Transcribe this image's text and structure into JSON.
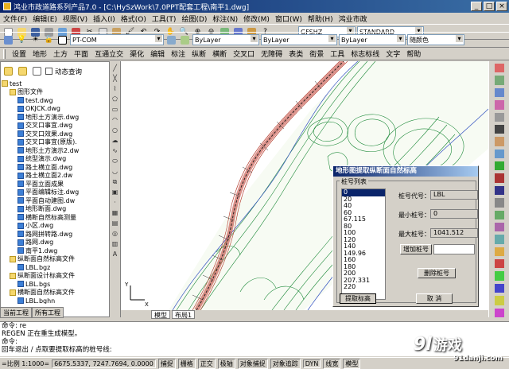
{
  "window": {
    "title": "鸿业市政道路系列产品7.0 - [C:\\HySzWork\\7.0PPT配套工程\\南平1.dwg]"
  },
  "menu1": [
    "文件(F)",
    "编辑(E)",
    "视图(V)",
    "插入(I)",
    "格式(O)",
    "工具(T)",
    "绘图(D)",
    "标注(N)",
    "修改(M)",
    "窗口(W)",
    "帮助(H)",
    "鸿业市政"
  ],
  "toolbar": {
    "layer_combo": "PT-COM",
    "color_combo": "ByLayer",
    "linetype_combo": "ByLayer",
    "lineweight_combo": "ByLayer",
    "plotstyle_combo": "随颜色",
    "textstyle_combo": "GFSHZ",
    "dimstyle_combo": "STANDARD"
  },
  "menu2": [
    "设置",
    "地形",
    "土方",
    "平面",
    "互通立交",
    "渠化",
    "编辑",
    "标注",
    "纵断",
    "横断",
    "交叉口",
    "无障碍",
    "表类",
    "街景",
    "工具",
    "标志标线",
    "文字",
    "帮助"
  ],
  "left_panel": {
    "checkbox_label": "动态查询",
    "tree": [
      {
        "level": 0,
        "type": "fold",
        "label": "test"
      },
      {
        "level": 1,
        "type": "fold",
        "label": "图形文件"
      },
      {
        "level": 2,
        "type": "file",
        "label": "test.dwg"
      },
      {
        "level": 2,
        "type": "file",
        "label": "OKJCK.dwg"
      },
      {
        "level": 2,
        "type": "file",
        "label": "地形土方演示.dwg"
      },
      {
        "level": 2,
        "type": "file",
        "label": "交叉口事宜.dwg"
      },
      {
        "level": 2,
        "type": "file",
        "label": "交叉口效果.dwg"
      },
      {
        "level": 2,
        "type": "file",
        "label": "交叉口事宜(原版)."
      },
      {
        "level": 2,
        "type": "file",
        "label": "地形土方演示2.dw"
      },
      {
        "level": 2,
        "type": "file",
        "label": "统型演示.dwg"
      },
      {
        "level": 2,
        "type": "file",
        "label": "路土横立面.dwg"
      },
      {
        "level": 2,
        "type": "file",
        "label": "路土横立面2.dw"
      },
      {
        "level": 2,
        "type": "file",
        "label": "平面立面成果"
      },
      {
        "level": 2,
        "type": "file",
        "label": "平面编辑标注.dwg"
      },
      {
        "level": 2,
        "type": "file",
        "label": "平面自动建图.dw"
      },
      {
        "level": 2,
        "type": "file",
        "label": "地形断面.dwg"
      },
      {
        "level": 2,
        "type": "file",
        "label": "横断自然标高测量"
      },
      {
        "level": 2,
        "type": "file",
        "label": "小区.dwg"
      },
      {
        "level": 2,
        "type": "file",
        "label": "路网拼转路.dwg"
      },
      {
        "level": 2,
        "type": "file",
        "label": "路网.dwg"
      },
      {
        "level": 2,
        "type": "file",
        "label": "南平1.dwg"
      },
      {
        "level": 1,
        "type": "fold",
        "label": "纵断面自然标高文件"
      },
      {
        "level": 2,
        "type": "file",
        "label": "LBL.bgz"
      },
      {
        "level": 1,
        "type": "fold",
        "label": "纵断面设计标高文件"
      },
      {
        "level": 2,
        "type": "file",
        "label": "LBL.bgs"
      },
      {
        "level": 1,
        "type": "fold",
        "label": "横断面自然标高文件"
      },
      {
        "level": 2,
        "type": "file",
        "label": "LBL.bghn"
      }
    ],
    "tabs": [
      "当前工程",
      "所有工程"
    ]
  },
  "layout_tabs": [
    "模型",
    "布局1"
  ],
  "dialog": {
    "title": "地形图提取纵断面自然标高",
    "group_label": "桩号列表",
    "list": [
      "0",
      "20",
      "40",
      "60",
      "67.115",
      "80",
      "100",
      "120",
      "140",
      "149.96",
      "160",
      "180",
      "200",
      "207.331",
      "220"
    ],
    "selected_index": 0,
    "code_label": "桩号代号：",
    "code_value": "LBL",
    "min_label": "最小桩号：",
    "min_value": "0",
    "max_label": "最大桩号：",
    "max_value": "1041.512",
    "add_button": "增加桩号",
    "add_input": "",
    "delete_button": "删除桩号",
    "extract_button": "提取标高",
    "cancel_button": "取 消"
  },
  "command": {
    "lines": [
      "命令: re",
      "REGEN 正在重生成模型。",
      "命令:",
      "回车退出 / 点取要提取标高的桩号线:"
    ]
  },
  "status": {
    "scale": "=比例 1:1000=",
    "coords": "6675.5337, 7247.7694, 0.0000",
    "toggles": [
      "捕捉",
      "栅格",
      "正交",
      "极轴",
      "对象捕捉",
      "对象追踪",
      "DYN",
      "线宽",
      "模型"
    ]
  },
  "watermark": {
    "logo": "9l",
    "name": "游戏",
    "url": "91danji.com"
  },
  "colors": {
    "titlebar": "#0a246a",
    "road": "#c0392b",
    "contour": "#1e8a3a",
    "selection": "#0a246a"
  }
}
